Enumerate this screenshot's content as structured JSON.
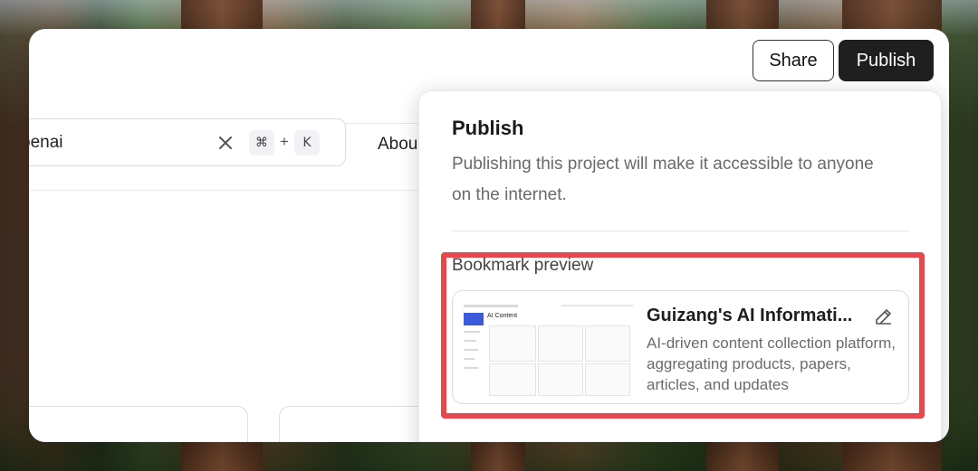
{
  "header": {
    "share_label": "Share",
    "publish_label": "Publish"
  },
  "search": {
    "value": "penai"
  },
  "shortcut": {
    "key1": "⌘",
    "plus": "+",
    "key2": "K"
  },
  "nav": {
    "about_label": "Abou"
  },
  "popover": {
    "title": "Publish",
    "description": "Publishing this project will make it accessible to anyone on the internet.",
    "bookmark_label": "Bookmark preview",
    "bookmark": {
      "title": "Guizang's AI Informati...",
      "description": "AI-driven content collection platform, aggregating products, papers, articles, and updates",
      "thumb_heading": "AI Content"
    }
  },
  "colors": {
    "highlight": "#e5484d",
    "publish_bg": "#1f1f1f"
  },
  "icons": {
    "clear": "close-icon",
    "edit": "pencil-icon"
  }
}
